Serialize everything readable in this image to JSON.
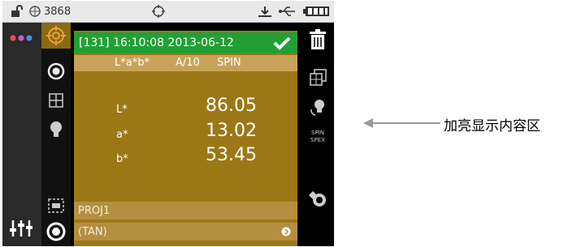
{
  "status": {
    "battery_count": "3868"
  },
  "measurement": {
    "header": "[131] 16:10:08 2013-06-12",
    "space": "L*a*b*",
    "illuminant": "A/10",
    "mode": "SPIN",
    "rows": [
      {
        "label": "L*",
        "value": "86.05"
      },
      {
        "label": "a*",
        "value": "13.02"
      },
      {
        "label": "b*",
        "value": "53.45"
      }
    ],
    "project": "PROJ1",
    "standard": "(TAN)"
  },
  "side": {
    "spin_spex_label_top": "SPIN",
    "spin_spex_label_bottom": "SPEX"
  },
  "annotation": {
    "text": "加亮显示内容区"
  },
  "colors": {
    "header_green": "#21a035",
    "panel_gold": "#9c7716",
    "bar_tan": "#b58f40",
    "accent_orange": "#e6a23c"
  }
}
